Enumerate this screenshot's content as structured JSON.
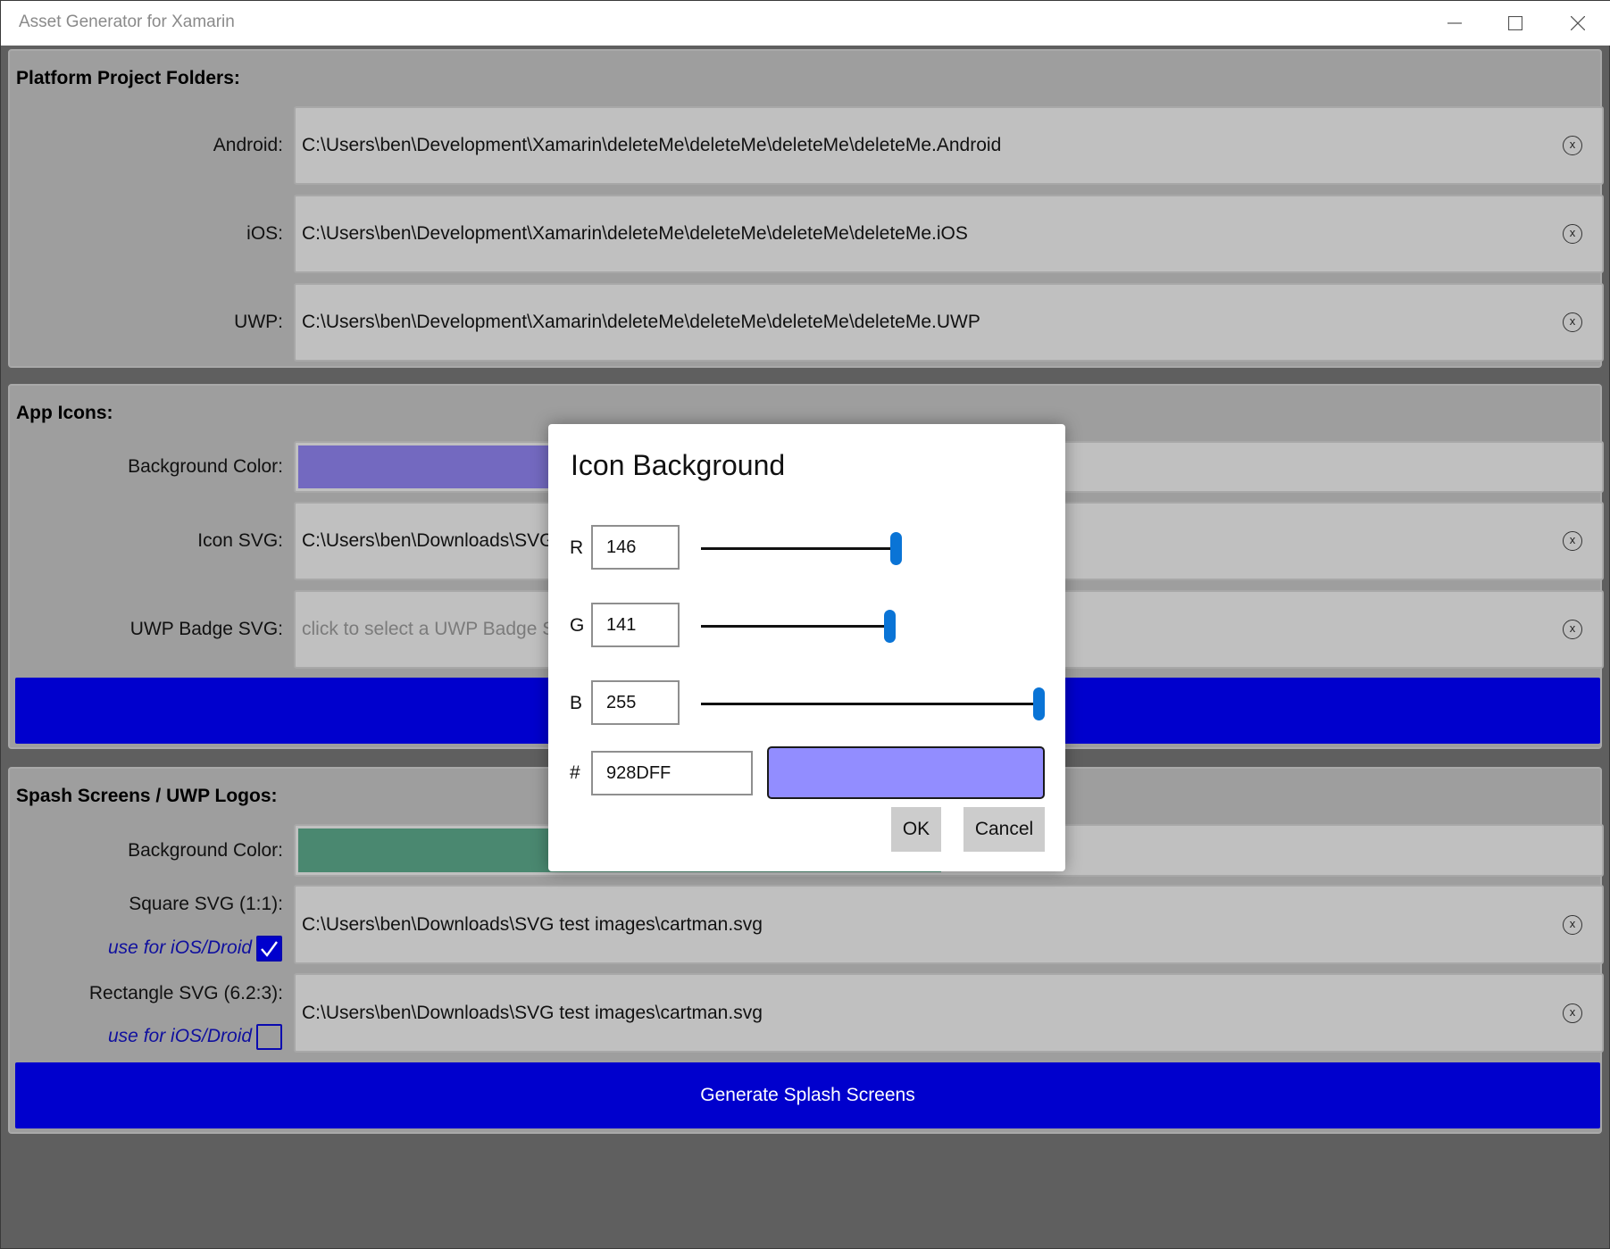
{
  "window": {
    "title": "Asset Generator for Xamarin"
  },
  "platform_section": {
    "title": "Platform Project Folders:",
    "rows": [
      {
        "label": "Android:",
        "value": "C:\\Users\\ben\\Development\\Xamarin\\deleteMe\\deleteMe\\deleteMe\\deleteMe.Android"
      },
      {
        "label": "iOS:",
        "value": "C:\\Users\\ben\\Development\\Xamarin\\deleteMe\\deleteMe\\deleteMe\\deleteMe.iOS"
      },
      {
        "label": "UWP:",
        "value": "C:\\Users\\ben\\Development\\Xamarin\\deleteMe\\deleteMe\\deleteMe\\deleteMe.UWP"
      }
    ]
  },
  "app_icons_section": {
    "title": "App Icons:",
    "background_color_label": "Background Color:",
    "background_color": "#7369c0",
    "icon_svg_label": "Icon SVG:",
    "icon_svg_value": "C:\\Users\\ben\\Downloads\\SVG t",
    "uwp_badge_label": "UWP Badge SVG:",
    "uwp_badge_placeholder": "click to select a UWP Badge SV",
    "button_color": "#0000cd"
  },
  "splash_section": {
    "title": "Spash Screens / UWP Logos:",
    "background_color_label": "Background Color:",
    "background_color": "#4a8870",
    "square_label": "Square SVG (1:1):",
    "square_value": "C:\\Users\\ben\\Downloads\\SVG test images\\cartman.svg",
    "square_use_label": "use for iOS/Droid",
    "square_use_checked": true,
    "rect_label": "Rectangle SVG (6.2:3):",
    "rect_value": "C:\\Users\\ben\\Downloads\\SVG test images\\cartman.svg",
    "rect_use_label": "use for iOS/Droid",
    "rect_use_checked": false,
    "generate_label": "Generate Splash Screens"
  },
  "dialog": {
    "title": "Icon Background",
    "r_label": "R",
    "r_value": "146",
    "g_label": "G",
    "g_value": "141",
    "b_label": "B",
    "b_value": "255",
    "hex_label": "#",
    "hex_value": "928DFF",
    "preview_color": "#928dff",
    "ok_label": "OK",
    "cancel_label": "Cancel"
  }
}
